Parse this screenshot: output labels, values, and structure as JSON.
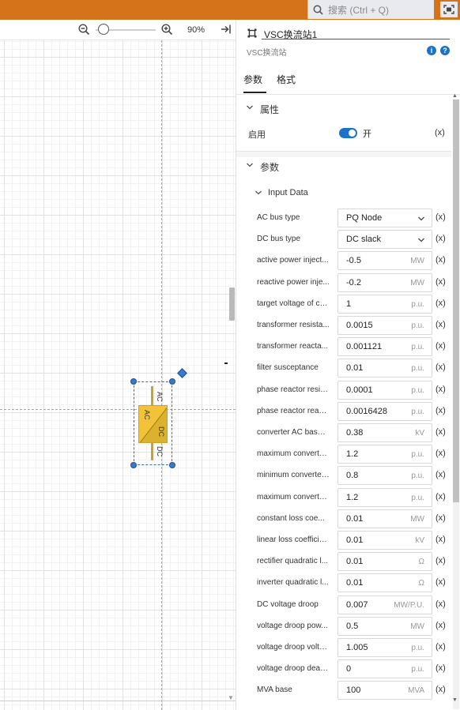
{
  "topbar": {
    "search_placeholder": "搜索 (Ctrl + Q)"
  },
  "canvas": {
    "zoom_level": "90%",
    "component": {
      "label_ac_top": "AC",
      "label_ac_box": "AC",
      "label_dc_box": "DC",
      "label_dc_bottom": "DC"
    }
  },
  "panel": {
    "title": "VSC换流站1",
    "subtitle": "VSC换流站",
    "info_glyph": "i",
    "help_glyph": "?",
    "tabs": [
      {
        "label": "参数"
      },
      {
        "label": "格式"
      }
    ],
    "attributes_section": {
      "title": "属性",
      "enable_label": "启用",
      "enable_state": "开",
      "expr_label": "(x)"
    },
    "params_section": {
      "title": "参数",
      "input_data_title": "Input Data"
    },
    "rows": [
      {
        "label": "AC bus type",
        "value": "PQ Node",
        "unit": "",
        "dropdown": true,
        "x": "(x)"
      },
      {
        "label": "DC bus type",
        "value": "DC slack",
        "unit": "",
        "dropdown": true,
        "x": "(x)"
      },
      {
        "label": "active power inject...",
        "value": "-0.5",
        "unit": "MW",
        "x": "(x)"
      },
      {
        "label": "reactive power inje...",
        "value": "-0.2",
        "unit": "MW",
        "x": "(x)"
      },
      {
        "label": "target voltage of co...",
        "value": "1",
        "unit": "p.u.",
        "x": "(x)"
      },
      {
        "label": "transformer resista...",
        "value": "0.0015",
        "unit": "p.u.",
        "x": "(x)"
      },
      {
        "label": "transformer reacta...",
        "value": "0.001121",
        "unit": "p.u.",
        "x": "(x)"
      },
      {
        "label": "filter susceptance",
        "value": "0.01",
        "unit": "p.u.",
        "x": "(x)"
      },
      {
        "label": "phase reactor resis...",
        "value": "0.0001",
        "unit": "p.u.",
        "x": "(x)"
      },
      {
        "label": "phase reactor react...",
        "value": "0.0016428",
        "unit": "p.u.",
        "x": "(x)"
      },
      {
        "label": "converter AC base ...",
        "value": "0.38",
        "unit": "kV",
        "x": "(x)"
      },
      {
        "label": "maximum converte...",
        "value": "1.2",
        "unit": "p.u.",
        "x": "(x)"
      },
      {
        "label": "minimum converter...",
        "value": "0.8",
        "unit": "p.u.",
        "x": "(x)"
      },
      {
        "label": "maximum converte...",
        "value": "1.2",
        "unit": "p.u.",
        "x": "(x)"
      },
      {
        "label": "constant loss coe...",
        "value": "0.01",
        "unit": "MW",
        "x": "(x)"
      },
      {
        "label": "linear loss coefficie...",
        "value": "0.01",
        "unit": "kV",
        "x": "(x)"
      },
      {
        "label": "rectifier quadratic l...",
        "value": "0.01",
        "unit": "Ω",
        "x": "(x)"
      },
      {
        "label": "inverter quadratic l...",
        "value": "0.01",
        "unit": "Ω",
        "x": "(x)"
      },
      {
        "label": "DC voltage droop",
        "value": "0.007",
        "unit": "MW/P.U.",
        "x": "(x)"
      },
      {
        "label": "voltage droop pow...",
        "value": "0.5",
        "unit": "MW",
        "x": "(x)"
      },
      {
        "label": "voltage droop volta...",
        "value": "1.005",
        "unit": "p.u.",
        "x": "(x)"
      },
      {
        "label": "voltage droop dead...",
        "value": "0",
        "unit": "p.u.",
        "x": "(x)"
      },
      {
        "label": "MVA base",
        "value": "100",
        "unit": "MVA",
        "x": "(x)"
      }
    ]
  },
  "colors": {
    "topbar": "#d4731a",
    "accent": "#1a73c8",
    "component_fill": "#f2c338",
    "component_dark": "#c9a227"
  }
}
